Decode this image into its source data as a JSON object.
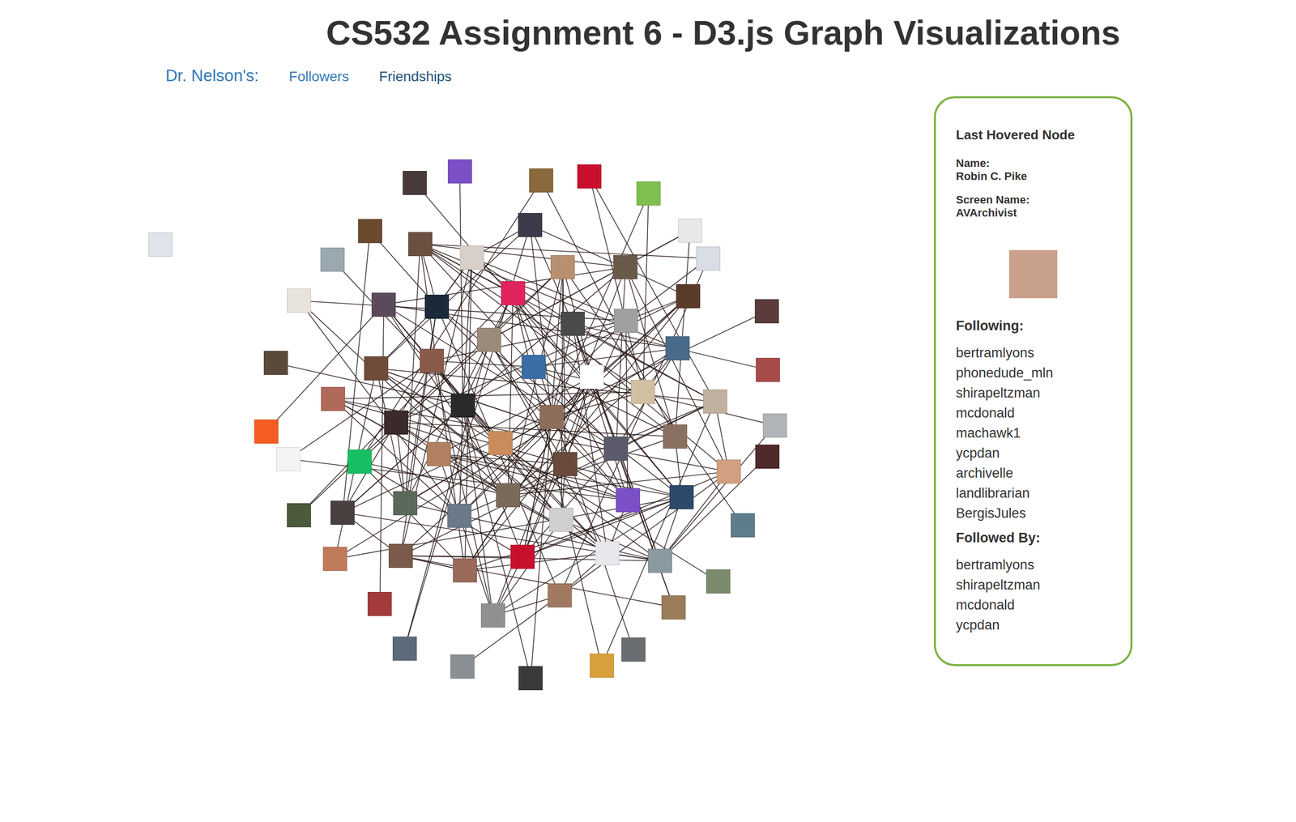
{
  "page": {
    "title": "CS532 Assignment 6 - D3.js Graph Visualizations"
  },
  "nav": {
    "label": "Dr. Nelson's:",
    "links": [
      {
        "label": "Followers",
        "selected": false
      },
      {
        "label": "Friendships",
        "selected": true
      }
    ]
  },
  "graph": {
    "nodes": [
      {
        "color": "#9aa8b0"
      },
      {
        "color": "#6b4a2e"
      },
      {
        "color": "#4a3b3b"
      },
      {
        "color": "#7b4fc6"
      },
      {
        "color": "#8a6a3c"
      },
      {
        "color": "#c8102e"
      },
      {
        "color": "#7fbf4f"
      },
      {
        "color": "#e8e8e8"
      },
      {
        "color": "#d9dde6"
      },
      {
        "color": "#5a3d3a"
      },
      {
        "color": "#a84b4b"
      },
      {
        "color": "#b0b4b8"
      },
      {
        "color": "#4f2a2a"
      },
      {
        "color": "#5e7c8a"
      },
      {
        "color": "#7a8a6a"
      },
      {
        "color": "#9a7b5a"
      },
      {
        "color": "#6a6e72"
      },
      {
        "color": "#d8a03a"
      },
      {
        "color": "#3a3a3a"
      },
      {
        "color": "#8a8f94"
      },
      {
        "color": "#5c6a7a"
      },
      {
        "color": "#a33b3b"
      },
      {
        "color": "#c07a5a"
      },
      {
        "color": "#4a5a3a"
      },
      {
        "color": "#f4f4f4"
      },
      {
        "color": "#f45d22"
      },
      {
        "color": "#5a4a3a"
      },
      {
        "color": "#e8e4dc"
      },
      {
        "color": "#8c6e5a"
      },
      {
        "color": "#c98c5a"
      },
      {
        "color": "#3b6ea5"
      },
      {
        "color": "#6a4a3a"
      },
      {
        "color": "#2a2a2a"
      },
      {
        "color": "#ffffff"
      },
      {
        "color": "#7a6a5a"
      },
      {
        "color": "#9a8a7a"
      },
      {
        "color": "#5a5a6a"
      },
      {
        "color": "#b08060"
      },
      {
        "color": "#4a4a4a"
      },
      {
        "color": "#cfcfcf"
      },
      {
        "color": "#8a5a4a"
      },
      {
        "color": "#d0c0a0"
      },
      {
        "color": "#6a7a8a"
      },
      {
        "color": "#e0245e"
      },
      {
        "color": "#7b4fc6"
      },
      {
        "color": "#3a2a2a"
      },
      {
        "color": "#a0a0a0"
      },
      {
        "color": "#c8102e"
      },
      {
        "color": "#1a2a3a"
      },
      {
        "color": "#8a7060"
      },
      {
        "color": "#5a6a5a"
      },
      {
        "color": "#b89070"
      },
      {
        "color": "#e8e8ec"
      },
      {
        "color": "#704a3a"
      },
      {
        "color": "#4a6a8a"
      },
      {
        "color": "#9a6a5a"
      },
      {
        "color": "#d8d0c8"
      },
      {
        "color": "#2e4a6a"
      },
      {
        "color": "#17bf63"
      },
      {
        "color": "#6a5a4a"
      },
      {
        "color": "#a07a60"
      },
      {
        "color": "#5a4a5a"
      },
      {
        "color": "#c0b0a0"
      },
      {
        "color": "#7a5a4a"
      },
      {
        "color": "#3a3a4a"
      },
      {
        "color": "#8a9aa0"
      },
      {
        "color": "#b06a5a"
      },
      {
        "color": "#5a3a2a"
      },
      {
        "color": "#909090"
      },
      {
        "color": "#6a5040"
      },
      {
        "color": "#d0a080"
      },
      {
        "color": "#4a4040"
      }
    ],
    "isolated_node": {
      "color": "#dfe3ea"
    }
  },
  "panel": {
    "title": "Last Hovered Node",
    "name_label": "Name:",
    "name": "Robin C. Pike",
    "screen_name_label": "Screen Name:",
    "screen_name": "AVArchivist",
    "photo_color": "#c9a08a",
    "following_label": "Following:",
    "following": [
      "bertramlyons",
      "phonedude_mln",
      "shirapeltzman",
      "mcdonald",
      "machawk1",
      "ycpdan",
      "archivelle",
      "landlibrarian",
      "BergisJules"
    ],
    "followed_by_label": "Followed By:",
    "followed_by": [
      "bertramlyons",
      "shirapeltzman",
      "mcdonald",
      "ycpdan"
    ]
  }
}
